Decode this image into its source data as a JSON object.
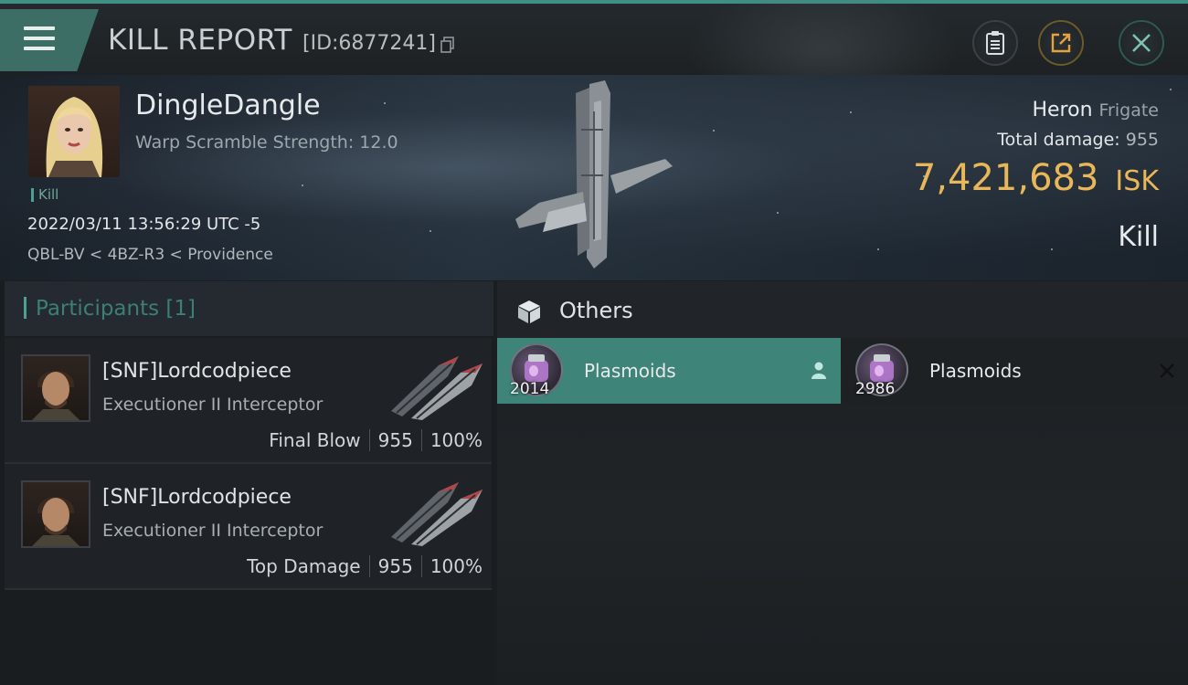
{
  "header": {
    "title": "KILL REPORT",
    "report_id": "[ID:6877241]"
  },
  "victim": {
    "name": "DingleDangle",
    "subtitle": "Warp Scramble Strength: 12.0",
    "tag": "Kill",
    "timestamp": "2022/03/11 13:56:29 UTC -5",
    "location": "QBL-BV < 4BZ-R3 < Providence",
    "ship": "Heron",
    "ship_class": "Frigate",
    "damage_label": "Total damage:",
    "damage_value": "955",
    "isk_value": "7,421,683",
    "isk_unit": "ISK",
    "result": "Kill"
  },
  "participants": {
    "heading": "Participants [1]",
    "rows": [
      {
        "name": "[SNF]Lordcodpiece",
        "ship": "Executioner II Interceptor",
        "role": "Final Blow",
        "damage": "955",
        "percent": "100%"
      },
      {
        "name": "[SNF]Lordcodpiece",
        "ship": "Executioner II Interceptor",
        "role": "Top Damage",
        "damage": "955",
        "percent": "100%"
      }
    ]
  },
  "others": {
    "heading": "Others",
    "items": [
      {
        "name": "Plasmoids",
        "qty": "2014"
      },
      {
        "name": "Plasmoids",
        "qty": "2986"
      }
    ]
  },
  "colors": {
    "accent": "#3f8478",
    "isk": "#e8b75a",
    "teal_text": "#3c7f74"
  }
}
